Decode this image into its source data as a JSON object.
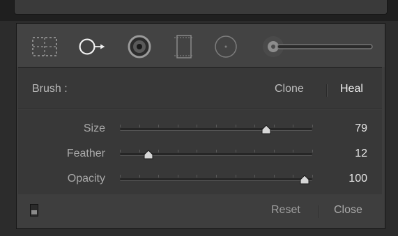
{
  "tools": [
    {
      "name": "crop-overlay",
      "icon": "crop-overlay-icon"
    },
    {
      "name": "spot-removal",
      "icon": "spot-removal-icon",
      "active": true
    },
    {
      "name": "red-eye",
      "icon": "red-eye-icon"
    },
    {
      "name": "graduated-filter",
      "icon": "graduated-filter-icon"
    },
    {
      "name": "radial-filter",
      "icon": "radial-filter-icon"
    },
    {
      "name": "adjustment-brush",
      "icon": "adjustment-brush-icon"
    }
  ],
  "brush": {
    "label": "Brush :",
    "modes": [
      "Clone",
      "Heal"
    ],
    "selected_mode": "Heal"
  },
  "sliders": [
    {
      "label": "Size",
      "value": "79",
      "fraction": 0.76
    },
    {
      "label": "Feather",
      "value": "12",
      "fraction": 0.15
    },
    {
      "label": "Opacity",
      "value": "100",
      "fraction": 0.96
    }
  ],
  "footer": {
    "reset_label": "Reset",
    "close_label": "Close"
  },
  "colors": {
    "panel_bg": "#3e3e3e",
    "text_active": "#f0f0f0",
    "text_muted": "#a8a8a8"
  }
}
